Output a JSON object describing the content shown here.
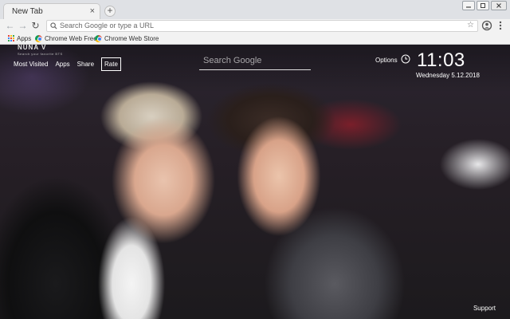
{
  "browser": {
    "tab_title": "New Tab",
    "tab_close": "×",
    "new_tab": "+",
    "omnibox_placeholder": "Search Google or type a URL",
    "bookmark_star": "☆",
    "nav_back": "←",
    "nav_forward": "→",
    "nav_reload": "↻",
    "icons": [
      "back-arrow-icon",
      "forward-arrow-icon",
      "reload-icon",
      "search-icon",
      "star-icon",
      "account-icon",
      "more-vert-icon",
      "apps-grid-icon",
      "chrome-web-store-icon",
      "minimize-icon",
      "maximize-icon",
      "close-icon"
    ]
  },
  "bookmarks": [
    {
      "label": "Apps"
    },
    {
      "label": "Chrome Web Freeo"
    },
    {
      "label": "Chrome Web Store"
    }
  ],
  "page": {
    "logo": "NUNA V",
    "logo_sub": "Search your favorite BTS",
    "nav": {
      "most_visited": "Most Visited",
      "apps": "Apps",
      "share": "Share",
      "rate": "Rate"
    },
    "search_placeholder": "Search Google",
    "options": "Options",
    "time": "11:03",
    "date": "Wednesday  5.12.2018",
    "support": "Support"
  },
  "colors": {
    "chrome_bg": "#dfe1e5",
    "toolbar_bg": "#f2f2f2",
    "overlay_text": "#ffffff",
    "apps_grid": [
      "#ea4335",
      "#fbbc05",
      "#34a853",
      "#4285f4",
      "#ea4335",
      "#fbbc05",
      "#34a853",
      "#4285f4",
      "#ea4335"
    ]
  }
}
